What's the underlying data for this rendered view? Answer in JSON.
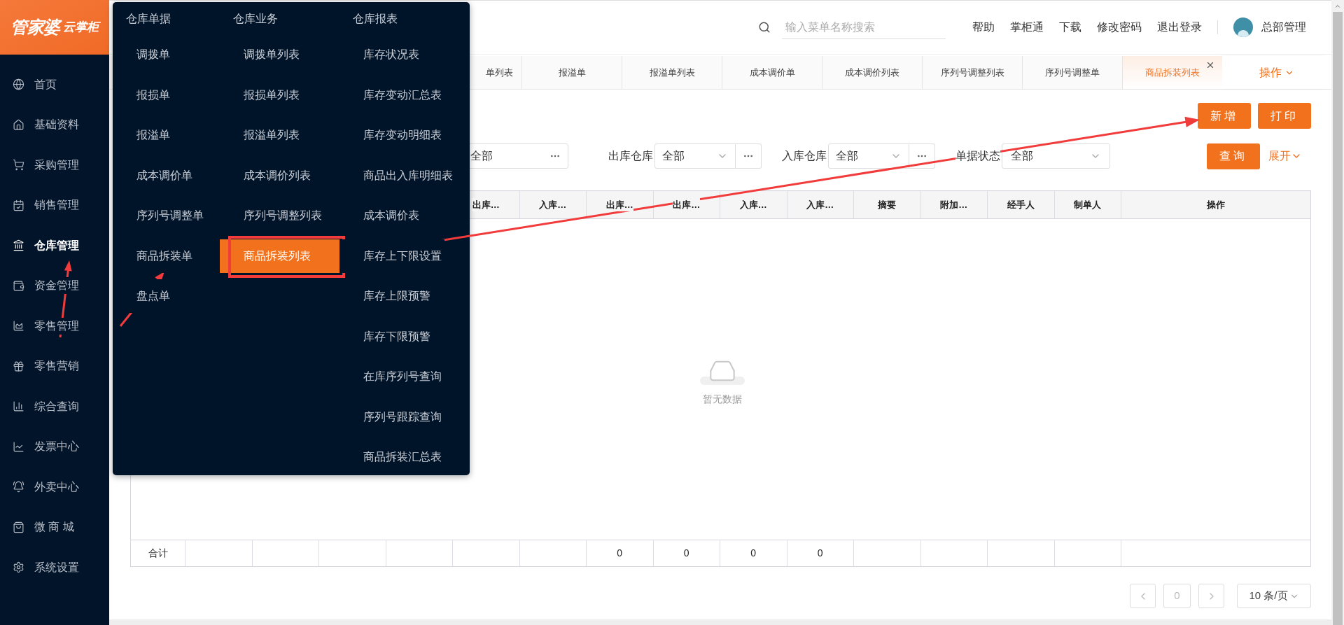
{
  "logo": {
    "brand": "管家婆",
    "product": "云掌柜"
  },
  "sidebar": {
    "items": [
      {
        "label": "首页",
        "selected": false
      },
      {
        "label": "基础资料",
        "selected": false
      },
      {
        "label": "采购管理",
        "selected": false
      },
      {
        "label": "销售管理",
        "selected": false
      },
      {
        "label": "仓库管理",
        "selected": true
      },
      {
        "label": "资金管理",
        "selected": false
      },
      {
        "label": "零售管理",
        "selected": false
      },
      {
        "label": "零售营销",
        "selected": false
      },
      {
        "label": "综合查询",
        "selected": false
      },
      {
        "label": "发票中心",
        "selected": false
      },
      {
        "label": "外卖中心",
        "selected": false
      },
      {
        "label": "微 商 城",
        "selected": false
      },
      {
        "label": "系统设置",
        "selected": false
      }
    ]
  },
  "flyout_menu": {
    "columns": [
      {
        "title": "仓库单据",
        "items": [
          {
            "label": "调拨单",
            "selected": false
          },
          {
            "label": "报损单",
            "selected": false
          },
          {
            "label": "报溢单",
            "selected": false
          },
          {
            "label": "成本调价单",
            "selected": false
          },
          {
            "label": "序列号调整单",
            "selected": false
          },
          {
            "label": "商品拆装单",
            "selected": false
          },
          {
            "label": "盘点单",
            "selected": false
          }
        ]
      },
      {
        "title": "仓库业务",
        "items": [
          {
            "label": "调拨单列表",
            "selected": false
          },
          {
            "label": "报损单列表",
            "selected": false
          },
          {
            "label": "报溢单列表",
            "selected": false
          },
          {
            "label": "成本调价列表",
            "selected": false
          },
          {
            "label": "序列号调整列表",
            "selected": false
          },
          {
            "label": "商品拆装列表",
            "selected": true
          }
        ]
      },
      {
        "title": "仓库报表",
        "items": [
          {
            "label": "库存状况表",
            "selected": false
          },
          {
            "label": "库存变动汇总表",
            "selected": false
          },
          {
            "label": "库存变动明细表",
            "selected": false
          },
          {
            "label": "商品出入库明细表",
            "selected": false
          },
          {
            "label": "成本调价表",
            "selected": false
          },
          {
            "label": "库存上下限设置",
            "selected": false
          },
          {
            "label": "库存上限预警",
            "selected": false
          },
          {
            "label": "库存下限预警",
            "selected": false
          },
          {
            "label": "在库序列号查询",
            "selected": false
          },
          {
            "label": "序列号跟踪查询",
            "selected": false
          },
          {
            "label": "商品拆装汇总表",
            "selected": false
          }
        ]
      }
    ]
  },
  "header": {
    "search": {
      "placeholder": "输入菜单名称搜索"
    },
    "links": [
      "帮助",
      "掌柜通",
      "下载",
      "修改密码",
      "退出登录"
    ],
    "user": "总部管理"
  },
  "tabs": [
    {
      "label": "单列表",
      "selected": false
    },
    {
      "label": "报溢单",
      "selected": false
    },
    {
      "label": "报溢单列表",
      "selected": false
    },
    {
      "label": "成本调价单",
      "selected": false
    },
    {
      "label": "成本调价列表",
      "selected": false
    },
    {
      "label": "序列号调整列表",
      "selected": false
    },
    {
      "label": "序列号调整单",
      "selected": false
    },
    {
      "label": "商品拆装列表",
      "selected": true
    }
  ],
  "tabs_menu": "操作",
  "toolbar": {
    "buttons": [
      "新增",
      "打印"
    ]
  },
  "filters": [
    {
      "kind": "picker",
      "value": "全部"
    },
    {
      "kind": "combo",
      "label": "出库仓库",
      "value": "全部"
    },
    {
      "kind": "combo",
      "label": "入库仓库",
      "value": "全部"
    },
    {
      "kind": "select",
      "label": "单据状态",
      "value": "全部"
    }
  ],
  "query_button": "查询",
  "expand_link": "展开",
  "table": {
    "columns": [
      "出库…",
      "入库…",
      "出库…",
      "出库…",
      "入库…",
      "入库…",
      "摘要",
      "附加…",
      "经手人",
      "制单人",
      "操作"
    ],
    "empty_text": "暂无数据",
    "totals": [
      {
        "kind": "label",
        "text": "合计"
      },
      {
        "kind": "blank"
      },
      {
        "kind": "blank"
      },
      {
        "kind": "blank"
      },
      {
        "kind": "blank"
      },
      {
        "kind": "blank"
      },
      {
        "kind": "blank"
      },
      {
        "kind": "value",
        "text": "0"
      },
      {
        "kind": "value",
        "text": "0"
      },
      {
        "kind": "value",
        "text": "0"
      },
      {
        "kind": "value",
        "text": "0"
      },
      {
        "kind": "blank"
      },
      {
        "kind": "blank"
      },
      {
        "kind": "blank"
      },
      {
        "kind": "blank"
      },
      {
        "kind": "blank"
      }
    ]
  },
  "pagination": {
    "page": "0",
    "page_size": "10 条/页"
  }
}
